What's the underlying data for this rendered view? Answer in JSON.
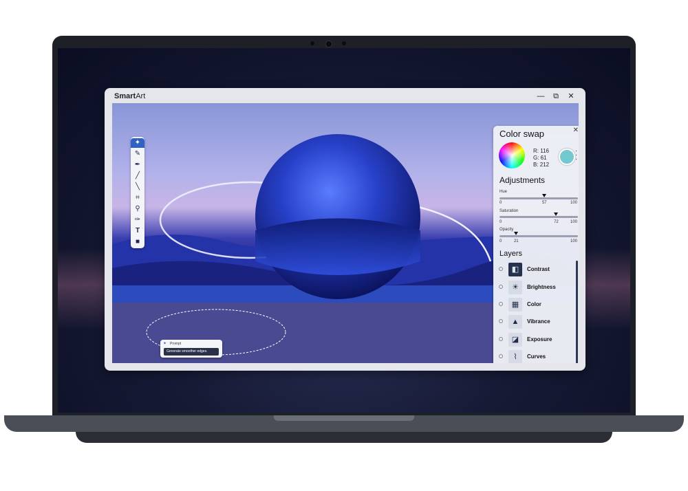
{
  "app": {
    "title_bold": "Smart",
    "title_rest": "Art",
    "minimize": "—",
    "restore": "⧉",
    "close": "✕"
  },
  "toolbar": {
    "tools": [
      {
        "name": "ai-sparkle-icon",
        "glyph": "✦"
      },
      {
        "name": "pin-icon",
        "glyph": "✎"
      },
      {
        "name": "pen-icon",
        "glyph": "✒"
      },
      {
        "name": "brush-icon",
        "glyph": "╱"
      },
      {
        "name": "pencil-icon",
        "glyph": "╲"
      },
      {
        "name": "crop-icon",
        "glyph": "⌗"
      },
      {
        "name": "magnify-icon",
        "glyph": "⚲"
      },
      {
        "name": "dropper-icon",
        "glyph": "✑"
      },
      {
        "name": "text-icon",
        "glyph": "T"
      },
      {
        "name": "shape-icon",
        "glyph": "■"
      }
    ]
  },
  "prompt": {
    "label": "Prompt",
    "value": "Generate smoother edges."
  },
  "panel": {
    "color_swap_title": "Color swap",
    "r": "R:  116",
    "g": "G:   61",
    "b": "B:  212",
    "swatch_color": "#74c8d0",
    "adjustments_title": "Adjustments",
    "sliders": [
      {
        "label": "Hue",
        "min": "0",
        "max": "100",
        "value": "57",
        "fraction": 0.57
      },
      {
        "label": "Saturation",
        "min": "0",
        "max": "100",
        "value": "72",
        "fraction": 0.72
      },
      {
        "label": "Opacity",
        "min": "0",
        "max": "100",
        "value": "21",
        "fraction": 0.21
      }
    ],
    "layers_title": "Layers",
    "layers": [
      {
        "label": "Contrast",
        "icon": "contrast-icon",
        "glyph": "◧"
      },
      {
        "label": "Brightness",
        "icon": "brightness-icon",
        "glyph": "☀"
      },
      {
        "label": "Color",
        "icon": "color-icon",
        "glyph": "▦"
      },
      {
        "label": "Vibrance",
        "icon": "vibrance-icon",
        "glyph": "▲"
      },
      {
        "label": "Exposure",
        "icon": "exposure-icon",
        "glyph": "◪"
      },
      {
        "label": "Curves",
        "icon": "curves-icon",
        "glyph": "⌇"
      }
    ]
  },
  "colors": {
    "accent": "#2f62c2",
    "sphere": "#2740c8"
  }
}
